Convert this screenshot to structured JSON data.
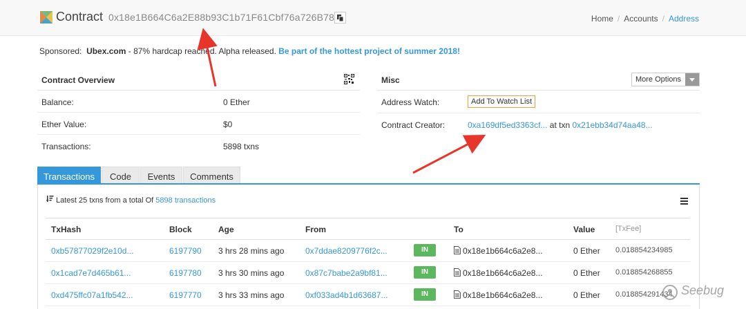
{
  "header": {
    "title": "Contract",
    "address": "0x18e1B664C6a2E88b93C1b71F61Cbf76a726B7801",
    "breadcrumb": [
      {
        "label": "Home"
      },
      {
        "label": "Accounts"
      },
      {
        "label": "Address"
      }
    ]
  },
  "sponsor": {
    "label": "Sponsored:",
    "name": "Ubex.com",
    "text": " - 87% hardcap reached. Alpha released.",
    "promo": "Be part of the hottest project of summer 2018!"
  },
  "overview": {
    "title": "Contract Overview",
    "rows": [
      {
        "label": "Balance:",
        "value": "0 Ether"
      },
      {
        "label": "Ether Value:",
        "value": "$0"
      },
      {
        "label": "Transactions:",
        "value": "5898 txns"
      }
    ]
  },
  "misc": {
    "title": "Misc",
    "more_options": "More Options",
    "address_watch_label": "Address Watch:",
    "watch_button": "Add To Watch List",
    "creator_label": "Contract Creator:",
    "creator_address": "0xa169df5ed3363cf...",
    "at_txn": "at txn",
    "creator_txn": "0x21ebb34d74aa48..."
  },
  "tabs": [
    {
      "label": "Transactions",
      "active": true
    },
    {
      "label": "Code"
    },
    {
      "label": "Events"
    },
    {
      "label": "Comments"
    }
  ],
  "summary": {
    "prefix": "Latest 25 txns from a total Of",
    "count_link": "5898 transactions"
  },
  "table": {
    "columns": [
      "TxHash",
      "Block",
      "Age",
      "From",
      "",
      "To",
      "Value",
      "[TxFee]"
    ],
    "rows": [
      {
        "hash": "0xb57877029f2e10d...",
        "block": "6197790",
        "age": "3 hrs 28 mins ago",
        "from": "0x7ddae8209776f2c...",
        "dir": "IN",
        "to": "0x18e1b664c6a2e8...",
        "value": "0 Ether",
        "fee": "0.018854234985"
      },
      {
        "hash": "0x1cad7e7d465b61...",
        "block": "6197780",
        "age": "3 hrs 30 mins ago",
        "from": "0x87c7babe2a9bf81...",
        "dir": "IN",
        "to": "0x18e1b664c6a2e8...",
        "value": "0 Ether",
        "fee": "0.018854268855"
      },
      {
        "hash": "0xd475ffc07a1fb542...",
        "block": "6197770",
        "age": "3 hrs 33 mins ago",
        "from": "0xf033ad4b1d63687...",
        "dir": "IN",
        "to": "0x18e1b664c6a2e8...",
        "value": "0 Ether",
        "fee": "0.018854291434"
      }
    ]
  },
  "watermark": "Seebug",
  "colors": {
    "accent": "#3498db",
    "in_badge": "#5cb85c",
    "arrow": "#e8352b",
    "watch_border": "#f0a040"
  }
}
